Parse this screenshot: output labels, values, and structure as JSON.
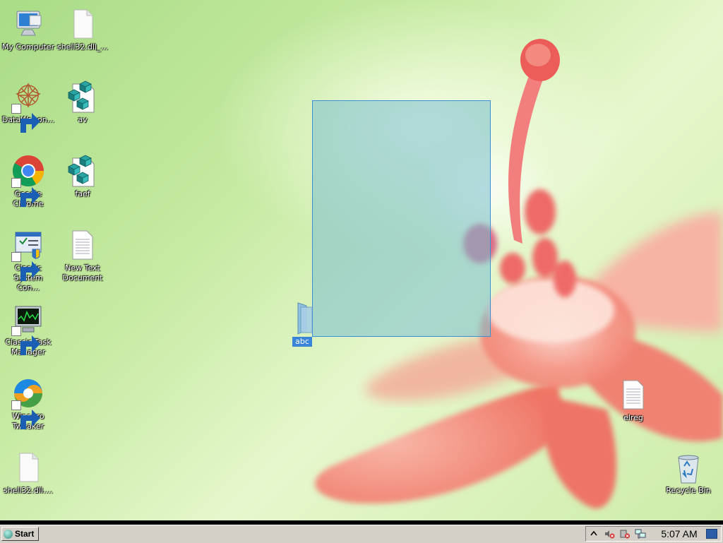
{
  "desktop": {
    "icons": [
      {
        "label": "My Computer",
        "icon": "computer-icon"
      },
      {
        "label": "shell32.dll_...",
        "icon": "file-icon"
      },
      {
        "label": "DataWagon...",
        "icon": "datawagon-icon"
      },
      {
        "label": "av",
        "icon": "registry-file-icon"
      },
      {
        "label": "Google Chrome",
        "icon": "chrome-icon"
      },
      {
        "label": "faef",
        "icon": "registry-file-icon"
      },
      {
        "label": "Classic System Con...",
        "icon": "control-panel-icon"
      },
      {
        "label": "New Text Document",
        "icon": "text-document-icon"
      },
      {
        "label": "Classic Task Manager",
        "icon": "task-manager-icon"
      },
      {
        "label": "Winaero Tweaker",
        "icon": "winaero-icon"
      },
      {
        "label": "shell32.dll....",
        "icon": "file-icon"
      },
      {
        "label": "abc",
        "icon": "folder-icon",
        "selected": true
      },
      {
        "label": "elreg",
        "icon": "text-document-icon"
      },
      {
        "label": "Recycle Bin",
        "icon": "recycle-bin-icon"
      }
    ]
  },
  "taskbar": {
    "start_label": "Start",
    "clock": "5:07 AM",
    "tray_icons": [
      "chevron-up-icon",
      "volume-muted-icon",
      "power-error-icon",
      "network-icon"
    ]
  },
  "colors": {
    "selection_fill": "#78becd",
    "selection_border": "#3b8fd9",
    "label_highlight": "#3a85d8"
  }
}
